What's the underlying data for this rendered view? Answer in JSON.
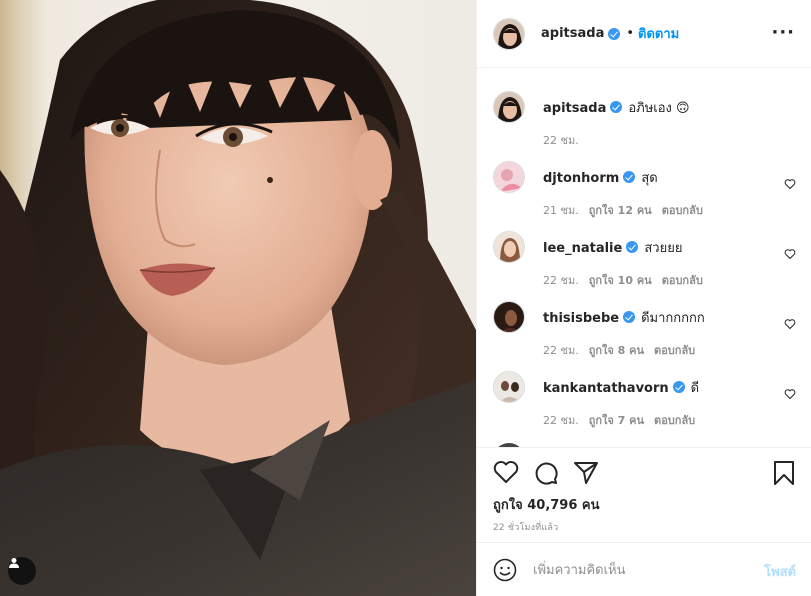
{
  "post": {
    "author": "apitsada",
    "follow_label": "ติดตาม",
    "dot": "•",
    "caption": {
      "username": "apitsada",
      "text": "อภิษเอง 🙃",
      "time": "22 ชม."
    }
  },
  "comments": [
    {
      "username": "djtonhorm",
      "text": "สุด",
      "time": "21 ชม.",
      "likes": "ถูกใจ 12 คน",
      "reply": "ตอบกลับ"
    },
    {
      "username": "lee_natalie",
      "text": "สวยยย",
      "time": "22 ชม.",
      "likes": "ถูกใจ 10 คน",
      "reply": "ตอบกลับ"
    },
    {
      "username": "thisisbebe",
      "text": "ดีมากกกกก",
      "time": "22 ชม.",
      "likes": "ถูกใจ 8 คน",
      "reply": "ตอบกลับ"
    },
    {
      "username": "kankantathavorn",
      "text": "ดี",
      "time": "22 ชม.",
      "likes": "ถูกใจ 7 คน",
      "reply": "ตอบกลับ"
    }
  ],
  "likes_label": "ถูกใจ 40,796 คน",
  "time_ago": "22 ชั่วโมงที่แล้ว",
  "comment_box": {
    "placeholder": "เพิ่มความคิดเห็น",
    "post_label": "โพสต์"
  },
  "icons": {
    "more": "more-options-icon",
    "like": "heart-icon",
    "comment": "comment-icon",
    "share": "paper-plane-icon",
    "save": "bookmark-icon",
    "emoji": "emoji-icon",
    "tag": "user-tag-icon",
    "verified": "verified-badge-icon"
  },
  "colors": {
    "accent": "#0095f6",
    "verified": "#3897f0",
    "muted": "#8e8e8e",
    "post_disabled": "#b2dffc"
  }
}
